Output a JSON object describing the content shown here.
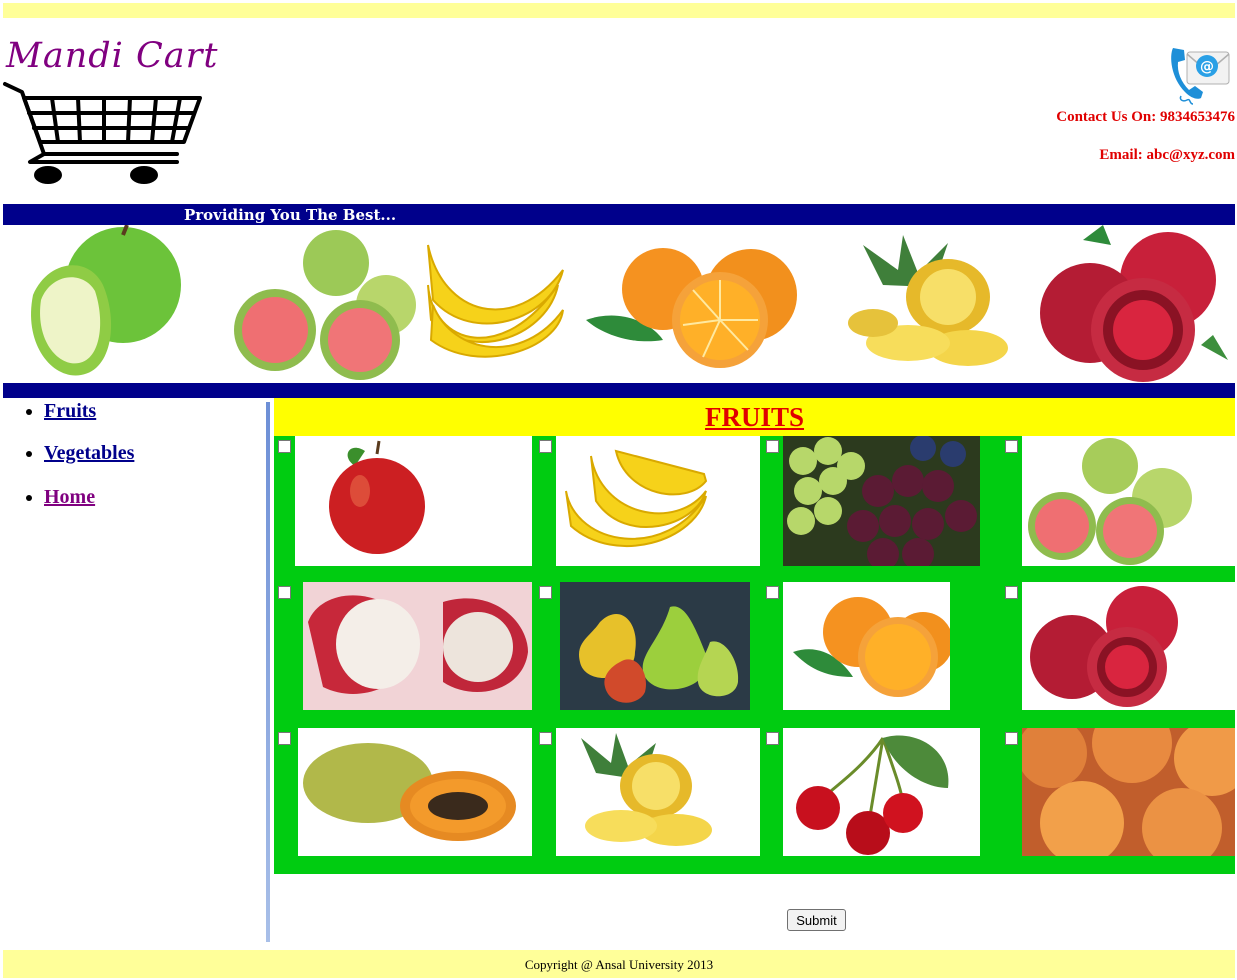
{
  "site": {
    "logo_title": "Mandi Cart",
    "contact_phone": "Contact Us On: 9834653476",
    "contact_email": "Email: abc@xyz.com",
    "tagline": "Providing You The Best...",
    "banner_fruits": [
      "green-apple",
      "guava",
      "banana",
      "orange",
      "pineapple",
      "pomegranate"
    ]
  },
  "nav": {
    "items": [
      {
        "label": "Fruits"
      },
      {
        "label": "Vegetables"
      },
      {
        "label": "Home"
      }
    ]
  },
  "content": {
    "heading": "FRUITS",
    "products": [
      {
        "fruit": "apple"
      },
      {
        "fruit": "banana"
      },
      {
        "fruit": "grapes"
      },
      {
        "fruit": "guava"
      },
      {
        "fruit": "rose-apple"
      },
      {
        "fruit": "pear"
      },
      {
        "fruit": "orange"
      },
      {
        "fruit": "pomegranate"
      },
      {
        "fruit": "papaya"
      },
      {
        "fruit": "pineapple"
      },
      {
        "fruit": "cherry"
      },
      {
        "fruit": "peach"
      }
    ],
    "submit_label": "Submit"
  },
  "footer": {
    "copyright": "Copyright @ Ansal University 2013"
  },
  "colors": {
    "navy": "#00008b",
    "pale_yellow": "#ffff99",
    "yellow": "#ffff00",
    "red": "#e00000",
    "green": "#00cc11",
    "purple": "#800080"
  }
}
